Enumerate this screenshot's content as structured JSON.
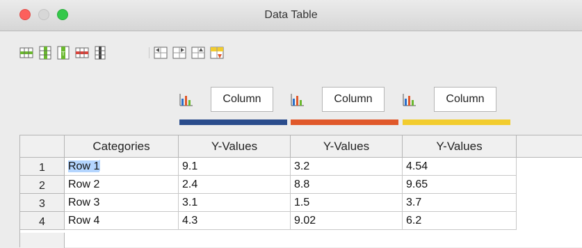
{
  "window": {
    "title": "Data Table"
  },
  "toolbar": {
    "buttons": [
      {
        "icon": "insert-row-icon"
      },
      {
        "icon": "insert-series-icon"
      },
      {
        "icon": "insert-text-column-icon"
      },
      {
        "icon": "delete-row-icon"
      },
      {
        "icon": "delete-series-icon"
      },
      {
        "icon": "move-series-left-icon"
      },
      {
        "icon": "move-series-right-icon"
      },
      {
        "icon": "move-row-up-icon"
      },
      {
        "icon": "move-row-down-icon"
      }
    ]
  },
  "series": [
    {
      "type_icon": "column-chart-icon",
      "name": "Column",
      "color": "#2a4c8c"
    },
    {
      "type_icon": "column-chart-icon",
      "name": "Column",
      "color": "#e0582a"
    },
    {
      "type_icon": "column-chart-icon",
      "name": "Column",
      "color": "#f2cc2e"
    }
  ],
  "table": {
    "headers": [
      "Categories",
      "Y-Values",
      "Y-Values",
      "Y-Values"
    ],
    "rows": [
      {
        "num": "1",
        "cells": [
          "Row 1",
          "9.1",
          "3.2",
          "4.54"
        ]
      },
      {
        "num": "2",
        "cells": [
          "Row 2",
          "2.4",
          "8.8",
          "9.65"
        ]
      },
      {
        "num": "3",
        "cells": [
          "Row 3",
          "3.1",
          "1.5",
          "3.7"
        ]
      },
      {
        "num": "4",
        "cells": [
          "Row 4",
          "4.3",
          "9.02",
          "6.2"
        ]
      }
    ]
  }
}
